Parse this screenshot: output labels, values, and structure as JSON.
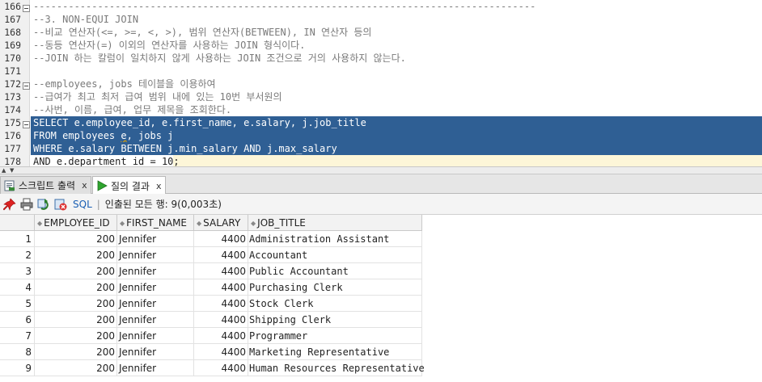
{
  "editor": {
    "lines": [
      {
        "n": "166",
        "text": "--------------------------------------------------------------------------------------",
        "kind": "comment"
      },
      {
        "n": "167",
        "text": "--3. NON-EQUI JOIN",
        "kind": "comment"
      },
      {
        "n": "168",
        "text": "--비교 연산자(<=, >=, <, >), 범위 연산자(BETWEEN), IN 연산자 등의",
        "kind": "comment"
      },
      {
        "n": "169",
        "text": "--동등 연산자(=) 이외의 연산자를 사용하는 JOIN 형식이다.",
        "kind": "comment"
      },
      {
        "n": "170",
        "text": "--JOIN 하는 칼럼이 일치하지 않게 사용하는 JOIN 조건으로 거의 사용하지 않는다.",
        "kind": "comment"
      },
      {
        "n": "171",
        "text": "",
        "kind": "plain"
      },
      {
        "n": "172",
        "text": "--employees, jobs 테이블을 이용하여",
        "kind": "comment"
      },
      {
        "n": "173",
        "text": "--급여가 최고 최저 급여 범위 내에 있는 10번 부서원의",
        "kind": "comment"
      },
      {
        "n": "174",
        "text": "--사번, 이름, 급여, 업무 제목을 조회한다.",
        "kind": "comment"
      },
      {
        "n": "175",
        "text": "SELECT e.employee_id, e.first_name, e.salary, j.job_title",
        "kind": "sel"
      },
      {
        "n": "176",
        "text": "FROM employees e, jobs j",
        "kind": "sel"
      },
      {
        "n": "177",
        "text": "WHERE e.salary BETWEEN j.min_salary AND j.max_salary",
        "kind": "sel"
      },
      {
        "n": "178",
        "text": "AND e.department_id = 10;",
        "kind": "partial"
      }
    ]
  },
  "tabs": [
    {
      "label": "스크립트 출력",
      "close": "x",
      "icon": "script-output-icon",
      "active": false
    },
    {
      "label": "질의 결과",
      "close": "x",
      "icon": "run-query-icon",
      "active": true
    }
  ],
  "toolbar": {
    "sql_label": "SQL",
    "separator": "|",
    "status": "인출된 모든 행: 9(0,003초)"
  },
  "grid": {
    "columns": [
      "EMPLOYEE_ID",
      "FIRST_NAME",
      "SALARY",
      "JOB_TITLE"
    ],
    "rows": [
      [
        "1",
        "200",
        "Jennifer",
        "4400",
        "Administration Assistant"
      ],
      [
        "2",
        "200",
        "Jennifer",
        "4400",
        "Accountant"
      ],
      [
        "3",
        "200",
        "Jennifer",
        "4400",
        "Public Accountant"
      ],
      [
        "4",
        "200",
        "Jennifer",
        "4400",
        "Purchasing Clerk"
      ],
      [
        "5",
        "200",
        "Jennifer",
        "4400",
        "Stock Clerk"
      ],
      [
        "6",
        "200",
        "Jennifer",
        "4400",
        "Shipping Clerk"
      ],
      [
        "7",
        "200",
        "Jennifer",
        "4400",
        "Programmer"
      ],
      [
        "8",
        "200",
        "Jennifer",
        "4400",
        "Marketing Representative"
      ],
      [
        "9",
        "200",
        "Jennifer",
        "4400",
        "Human Resources Representative"
      ]
    ]
  },
  "colors": {
    "selection": "#2f5f94",
    "current_line": "#fdf6d8",
    "comment": "#7a7a7a"
  }
}
